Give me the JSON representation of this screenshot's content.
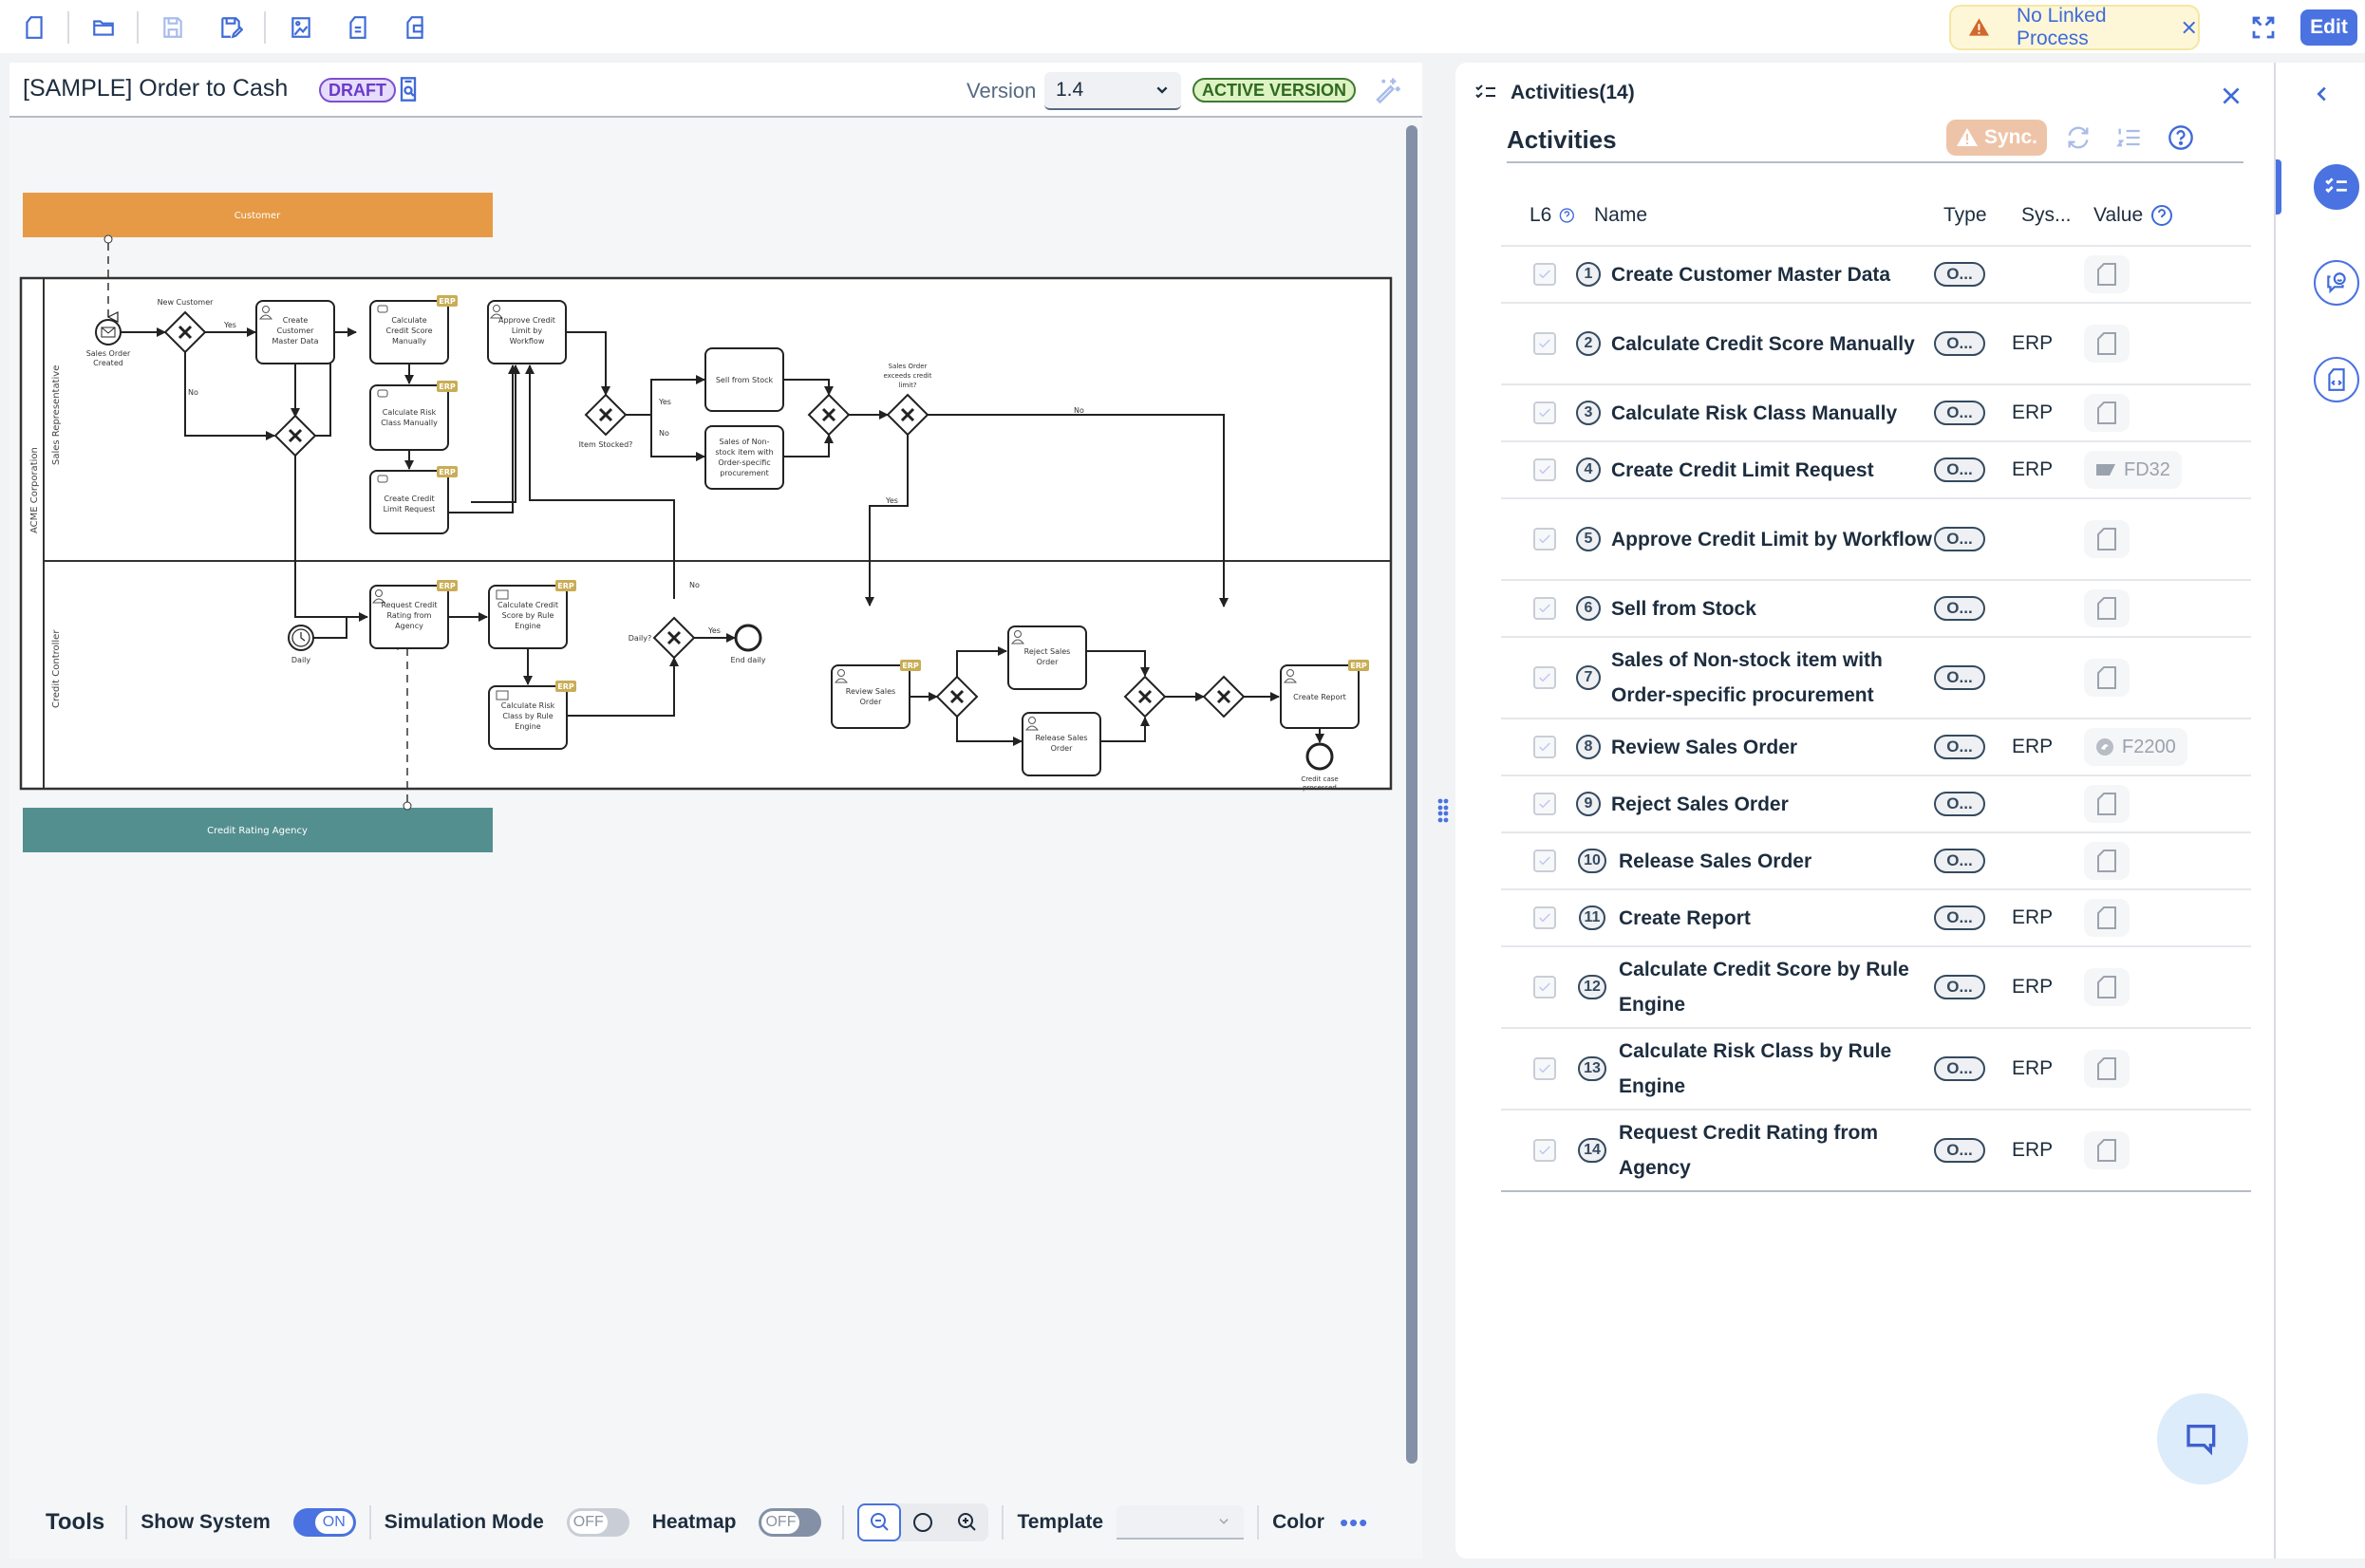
{
  "toolbar": {
    "icons": [
      "new-document-icon",
      "open-folder-icon",
      "save-icon",
      "save-as-icon",
      "export-image-icon",
      "export-document-icon",
      "export-file-icon"
    ],
    "notice": {
      "text": "No Linked Process",
      "icon": "warning-icon"
    },
    "edit_label": "Edit"
  },
  "editor": {
    "title": "[SAMPLE] Order to Cash",
    "status_badge": "DRAFT",
    "version_label": "Version",
    "version_value": "1.4",
    "active_badge": "ACTIVE VERSION"
  },
  "diagram": {
    "pools": {
      "customer": "Customer",
      "main": "ACME Corporation",
      "agency": "Credit Rating Agency"
    },
    "lanes": {
      "sales": "Sales Representative",
      "credit": "Credit Controller"
    },
    "events": {
      "start_sales_order": [
        "Sales Order",
        "Created"
      ],
      "timer_daily": "Daily",
      "end_daily": "End daily",
      "end_credit_case": [
        "Credit case",
        "processed"
      ]
    },
    "gateways": {
      "new_customer": "New Customer",
      "item_stocked": "Item Stocked?",
      "exceeds_limit": [
        "Sales Order",
        "exceeds credit",
        "limit?"
      ],
      "daily": "Daily?"
    },
    "flow_labels": {
      "yes": "Yes",
      "no": "No"
    },
    "erp_tag": "ERP",
    "tasks": {
      "create_customer": [
        "Create",
        "Customer",
        "Master Data"
      ],
      "calc_credit_manual": [
        "Calculate",
        "Credit Score",
        "Manually"
      ],
      "calc_risk_manual": [
        "Calculate Risk",
        "Class Manually"
      ],
      "create_credit_limit": [
        "Create Credit",
        "Limit Request"
      ],
      "approve_credit": [
        "Approve Credit",
        "Limit by",
        "Workflow"
      ],
      "sell_from_stock": [
        "Sell from Stock"
      ],
      "sales_nonstock": [
        "Sales of Non-",
        "stock item with",
        "Order-specific",
        "procurement"
      ],
      "request_rating": [
        "Request Credit",
        "Rating from",
        "Agency"
      ],
      "calc_credit_rule": [
        "Calculate Credit",
        "Score by Rule",
        "Engine"
      ],
      "calc_risk_rule": [
        "Calculate Risk",
        "Class by Rule",
        "Engine"
      ],
      "review_order": [
        "Review Sales",
        "Order"
      ],
      "reject_order": [
        "Reject Sales",
        "Order"
      ],
      "release_order": [
        "Release Sales",
        "Order"
      ],
      "create_report": [
        "Create Report"
      ]
    }
  },
  "tools": {
    "title": "Tools",
    "show_system": {
      "label": "Show System",
      "state": "ON"
    },
    "simulation": {
      "label": "Simulation Mode",
      "state": "OFF"
    },
    "heatmap": {
      "label": "Heatmap",
      "state": "OFF"
    },
    "template_label": "Template",
    "template_value": "",
    "color_label": "Color",
    "more": "•••"
  },
  "activities_panel": {
    "header": "Activities(14)",
    "subtitle": "Activities",
    "sync_label": "Sync.",
    "columns": {
      "l6": "L6",
      "name": "Name",
      "type": "Type",
      "system": "Sys...",
      "value": "Value"
    },
    "rows": [
      {
        "num": "1",
        "name": "Create Customer Master Data",
        "type": "O...",
        "system": "",
        "value": ""
      },
      {
        "num": "2",
        "name": "Calculate Credit Score Manually",
        "type": "O...",
        "system": "ERP",
        "value": ""
      },
      {
        "num": "3",
        "name": "Calculate Risk Class Manually",
        "type": "O...",
        "system": "ERP",
        "value": ""
      },
      {
        "num": "4",
        "name": "Create Credit Limit Request",
        "type": "O...",
        "system": "ERP",
        "value": "FD32"
      },
      {
        "num": "5",
        "name": "Approve Credit Limit by Workflow",
        "type": "O...",
        "system": "",
        "value": ""
      },
      {
        "num": "6",
        "name": "Sell from Stock",
        "type": "O...",
        "system": "",
        "value": ""
      },
      {
        "num": "7",
        "name": "Sales of Non-stock item with Order-specific procurement",
        "type": "O...",
        "system": "",
        "value": ""
      },
      {
        "num": "8",
        "name": "Review Sales Order",
        "type": "O...",
        "system": "ERP",
        "value": "F2200"
      },
      {
        "num": "9",
        "name": "Reject Sales Order",
        "type": "O...",
        "system": "",
        "value": ""
      },
      {
        "num": "10",
        "name": "Release Sales Order",
        "type": "O...",
        "system": "",
        "value": ""
      },
      {
        "num": "11",
        "name": "Create Report",
        "type": "O...",
        "system": "ERP",
        "value": ""
      },
      {
        "num": "12",
        "name": "Calculate Credit Score by Rule Engine",
        "type": "O...",
        "system": "ERP",
        "value": ""
      },
      {
        "num": "13",
        "name": "Calculate Risk Class by Rule Engine",
        "type": "O...",
        "system": "ERP",
        "value": ""
      },
      {
        "num": "14",
        "name": "Request Credit Rating from Agency",
        "type": "O...",
        "system": "ERP",
        "value": ""
      }
    ]
  },
  "colors": {
    "accent": "#4a72e0",
    "customer_pool": "#e69a45",
    "agency_pool": "#548f8f",
    "erp_tag": "#c9ad55",
    "draft": "#6a3ac8",
    "active": "#2e6a1f",
    "sync": "#eec4a8"
  }
}
